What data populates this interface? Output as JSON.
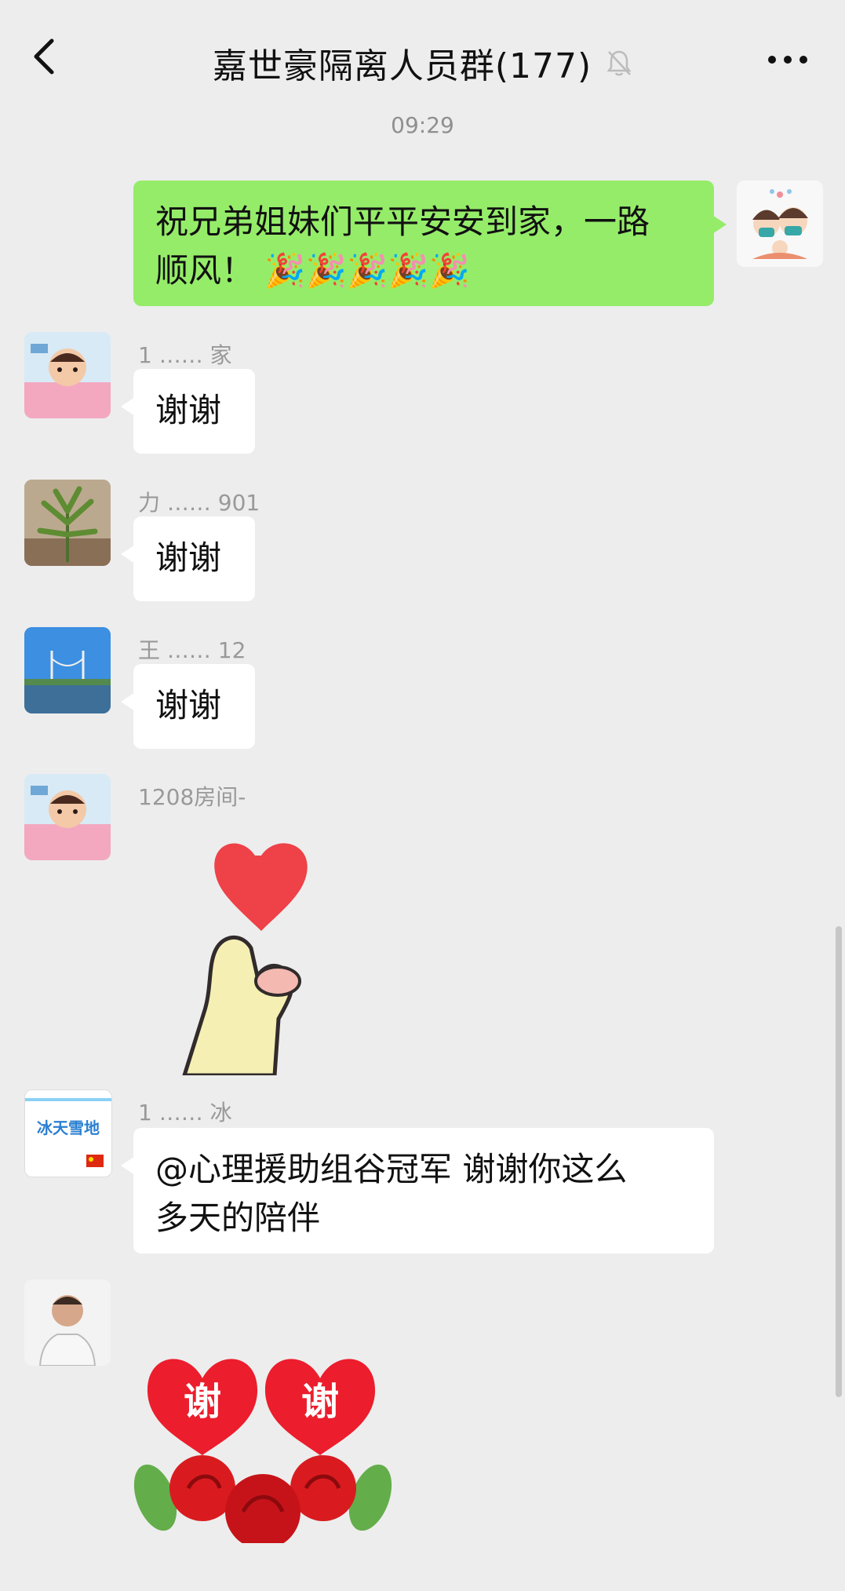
{
  "header": {
    "title": "嘉世豪隔离人员群(177)",
    "timestamp": "09:29",
    "icons": {
      "back": "chevron-left-icon",
      "mute": "bell-off-icon",
      "more": "more-icon"
    }
  },
  "messages": [
    {
      "sender": "self",
      "text_line1": "祝兄弟姐妹们平平安安到家，一路",
      "text_line2": "顺风！ 🎉🎉🎉🎉🎉"
    },
    {
      "sender_name": "1 …… 家",
      "text": "谢谢"
    },
    {
      "sender_name": "力 …… 901",
      "text": "谢谢"
    },
    {
      "sender_name": "王 …… 12",
      "text": "谢谢"
    },
    {
      "sender_name": "1208房间-",
      "sticker": "heart-finger-sticker"
    },
    {
      "sender_name": "1 …… 冰",
      "avatar_text": "冰天雪地",
      "text_line1": "@心理援助组谷冠军  谢谢你这么",
      "text_line2": "多天的陪伴"
    },
    {
      "sender_name": "",
      "sticker": "thank-you-hearts-roses-sticker",
      "sticker_text_1": "谢",
      "sticker_text_2": "谢"
    }
  ],
  "colors": {
    "background": "#ededed",
    "self_bubble": "#95ec69",
    "other_bubble": "#ffffff",
    "name_text": "#999999"
  }
}
